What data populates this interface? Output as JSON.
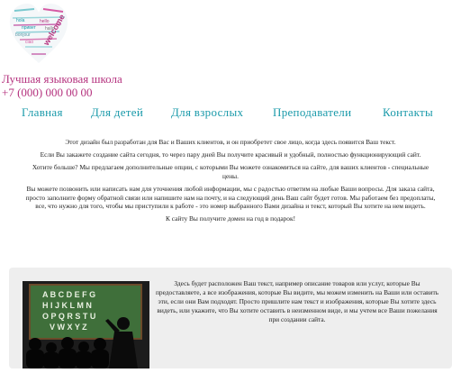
{
  "header": {
    "logo_words": [
      "welcome",
      "hola",
      "hello",
      "bonjour",
      "ciao",
      "привет",
      "hallo"
    ],
    "school_name": "Лучшая языковая школа",
    "phone": "+7 (000) 000 00 00"
  },
  "nav": {
    "items": [
      {
        "label": "Главная"
      },
      {
        "label": "Для детей"
      },
      {
        "label": "Для взрослых"
      },
      {
        "label": "Преподаватели"
      },
      {
        "label": "Контакты"
      }
    ]
  },
  "intro": {
    "paragraphs": [
      "Этот дизайн был разработан для Вас и Ваших клиентов, и он приобретет свое лицо, когда здесь появится Ваш текст.",
      "Если Вы закажете создание сайта сегодня, то через пару дней Вы получите красивый и удобный, полностью функционирующий сайт.",
      "Хотите больше? Мы предлагаем дополнительные опции, с которыми Вы можете ознакомиться на сайте, для ваших клиентов - специальные цены.",
      "Вы можете позвонить или написать нам для уточнения любой информации, мы с радостью ответим на любые Ваши вопросы. Для заказа сайта, просто заполните форму обратной связи или напишите нам на почту, и на следующий день Ваш сайт будет готов. Мы работаем без предоплаты, все, что нужно для того, чтобы мы приступили к работе - это номер выбранного Вами дизайна и текст, который Вы хотите на нем видеть.",
      "К сайту Вы получите домен на год в подарок!"
    ]
  },
  "panel": {
    "board_letters": [
      "A B C D E F G",
      "H I J K L M N",
      "O P Q R S T U",
      "V W X Y Z"
    ],
    "text": "Здесь будет расположен Ваш текст, например описание товаров или услуг, которые Вы предоставляете, а все изображения, которые Вы видите, мы можем изменить на Ваши или оставить эти, если они Вам подходят. Просто пришлите нам текст и изображения, которые Вы хотите здесь видеть, или укажите, что Вы хотите оставить в неизменном виде, и мы учтем все Ваши пожелания при создании сайта."
  }
}
